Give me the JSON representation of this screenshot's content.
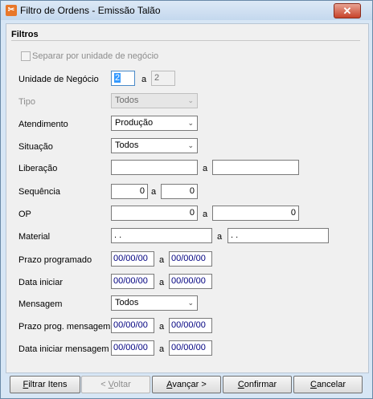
{
  "window": {
    "title": "Filtro de Ordens - Emissão Talão",
    "close_glyph": "✕",
    "app_icon": "app-icon"
  },
  "group": {
    "title": "Filtros"
  },
  "separar": {
    "label": "Separar por unidade de negócio",
    "checked": false
  },
  "unidade": {
    "label": "Unidade de Negócio",
    "from": "2",
    "sep": "a",
    "to": "2"
  },
  "tipo": {
    "label": "Tipo",
    "value": "Todos"
  },
  "atendimento": {
    "label": "Atendimento",
    "value": "Produção"
  },
  "situacao": {
    "label": "Situação",
    "value": "Todos"
  },
  "liberacao": {
    "label": "Liberação",
    "from": "",
    "sep": "a",
    "to": ""
  },
  "sequencia": {
    "label": "Sequência",
    "from": "0",
    "sep": "a",
    "to": "0"
  },
  "op": {
    "label": "OP",
    "from": "0",
    "sep": "a",
    "to": "0"
  },
  "material": {
    "label": "Material",
    "from": " .  .",
    "sep": "a",
    "to": " .  ."
  },
  "prazo": {
    "label": "Prazo programado",
    "from": "00/00/00",
    "sep": "a",
    "to": "00/00/00"
  },
  "data_iniciar": {
    "label": "Data iniciar",
    "from": "00/00/00",
    "sep": "a",
    "to": "00/00/00"
  },
  "mensagem": {
    "label": "Mensagem",
    "value": "Todos"
  },
  "prazo_msg": {
    "label": "Prazo prog. mensagem",
    "from": "00/00/00",
    "sep": "a",
    "to": "00/00/00"
  },
  "data_msg": {
    "label": "Data iniciar mensagem",
    "from": "00/00/00",
    "sep": "a",
    "to": "00/00/00"
  },
  "buttons": {
    "filtrar_key": "F",
    "filtrar_rest": "iltrar Itens",
    "voltar_pre": "< ",
    "voltar_key": "V",
    "voltar_rest": "oltar",
    "avancar_key": "A",
    "avancar_rest": "vançar >",
    "confirmar_key": "C",
    "confirmar_rest": "onfirmar",
    "cancelar_key": "C",
    "cancelar_rest": "ancelar"
  },
  "dropdown_icon": "chevron-down-icon"
}
